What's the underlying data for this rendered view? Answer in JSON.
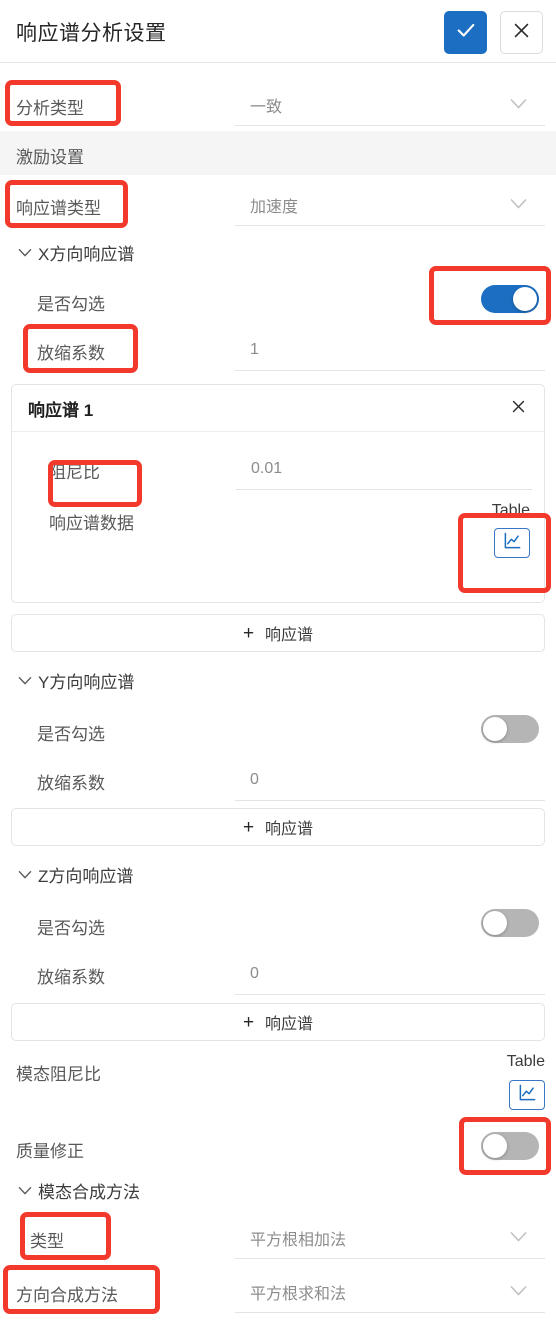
{
  "header": {
    "title": "响应谱分析设置",
    "confirm_icon": "check-icon",
    "cancel_icon": "close-icon"
  },
  "analysis_type": {
    "label": "分析类型",
    "value": "一致",
    "chevron": "chevron-down-icon"
  },
  "excitation_section": {
    "label": "激励设置"
  },
  "spectrum_type": {
    "label": "响应谱类型",
    "value": "加速度",
    "chevron": "chevron-down-icon"
  },
  "x_direction": {
    "group_label": "X方向响应谱",
    "chevron": "chevron-down-icon",
    "checked_label": "是否勾选",
    "checked_state": "on",
    "scale_label": "放缩系数",
    "scale_value": "1",
    "card": {
      "title": "响应谱 1",
      "close_icon": "close-icon",
      "damping_label": "阻尼比",
      "damping_value": "0.01",
      "data_label": "响应谱数据",
      "table_label": "Table",
      "chart_icon": "line-chart-icon"
    },
    "add_label": "响应谱",
    "add_icon": "plus-icon"
  },
  "y_direction": {
    "group_label": "Y方向响应谱",
    "chevron": "chevron-down-icon",
    "checked_label": "是否勾选",
    "checked_state": "off",
    "scale_label": "放缩系数",
    "scale_value": "0",
    "add_label": "响应谱",
    "add_icon": "plus-icon"
  },
  "z_direction": {
    "group_label": "Z方向响应谱",
    "chevron": "chevron-down-icon",
    "checked_label": "是否勾选",
    "checked_state": "off",
    "scale_label": "放缩系数",
    "scale_value": "0",
    "add_label": "响应谱",
    "add_icon": "plus-icon"
  },
  "modal_damping": {
    "label": "模态阻尼比",
    "table_label": "Table",
    "chart_icon": "line-chart-icon"
  },
  "mass_correction": {
    "label": "质量修正",
    "state": "off"
  },
  "modal_combination": {
    "group_label": "模态合成方法",
    "chevron": "chevron-down-icon",
    "type_label": "类型",
    "type_value": "平方根相加法",
    "dir_label": "方向合成方法",
    "dir_value": "平方根求和法"
  },
  "theme": {
    "accent": "#1b6ec2",
    "annotation": "#f2392c",
    "label_text": "#595959",
    "value_text": "#8c8c8c",
    "section_bg": "#f5f5f5",
    "toggle_off": "#b5b5b5"
  }
}
